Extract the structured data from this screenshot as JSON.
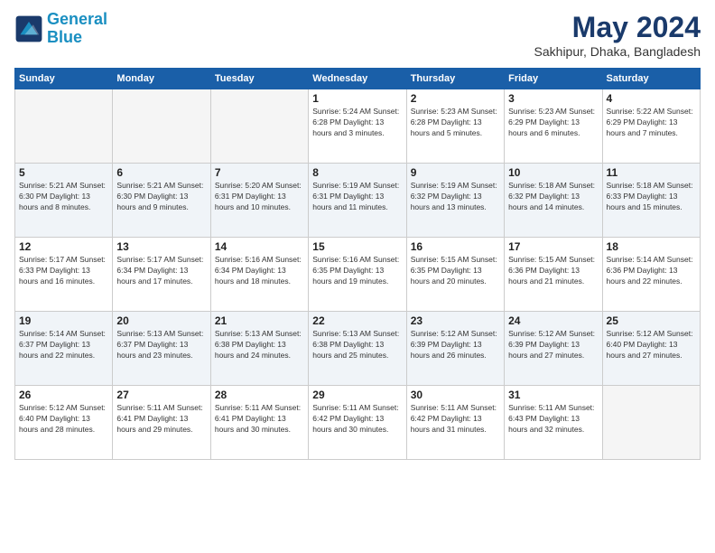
{
  "header": {
    "logo_line1": "General",
    "logo_line2": "Blue",
    "month": "May 2024",
    "location": "Sakhipur, Dhaka, Bangladesh"
  },
  "weekdays": [
    "Sunday",
    "Monday",
    "Tuesday",
    "Wednesday",
    "Thursday",
    "Friday",
    "Saturday"
  ],
  "weeks": [
    [
      {
        "day": "",
        "info": ""
      },
      {
        "day": "",
        "info": ""
      },
      {
        "day": "",
        "info": ""
      },
      {
        "day": "1",
        "info": "Sunrise: 5:24 AM\nSunset: 6:28 PM\nDaylight: 13 hours and 3 minutes."
      },
      {
        "day": "2",
        "info": "Sunrise: 5:23 AM\nSunset: 6:28 PM\nDaylight: 13 hours and 5 minutes."
      },
      {
        "day": "3",
        "info": "Sunrise: 5:23 AM\nSunset: 6:29 PM\nDaylight: 13 hours and 6 minutes."
      },
      {
        "day": "4",
        "info": "Sunrise: 5:22 AM\nSunset: 6:29 PM\nDaylight: 13 hours and 7 minutes."
      }
    ],
    [
      {
        "day": "5",
        "info": "Sunrise: 5:21 AM\nSunset: 6:30 PM\nDaylight: 13 hours and 8 minutes."
      },
      {
        "day": "6",
        "info": "Sunrise: 5:21 AM\nSunset: 6:30 PM\nDaylight: 13 hours and 9 minutes."
      },
      {
        "day": "7",
        "info": "Sunrise: 5:20 AM\nSunset: 6:31 PM\nDaylight: 13 hours and 10 minutes."
      },
      {
        "day": "8",
        "info": "Sunrise: 5:19 AM\nSunset: 6:31 PM\nDaylight: 13 hours and 11 minutes."
      },
      {
        "day": "9",
        "info": "Sunrise: 5:19 AM\nSunset: 6:32 PM\nDaylight: 13 hours and 13 minutes."
      },
      {
        "day": "10",
        "info": "Sunrise: 5:18 AM\nSunset: 6:32 PM\nDaylight: 13 hours and 14 minutes."
      },
      {
        "day": "11",
        "info": "Sunrise: 5:18 AM\nSunset: 6:33 PM\nDaylight: 13 hours and 15 minutes."
      }
    ],
    [
      {
        "day": "12",
        "info": "Sunrise: 5:17 AM\nSunset: 6:33 PM\nDaylight: 13 hours and 16 minutes."
      },
      {
        "day": "13",
        "info": "Sunrise: 5:17 AM\nSunset: 6:34 PM\nDaylight: 13 hours and 17 minutes."
      },
      {
        "day": "14",
        "info": "Sunrise: 5:16 AM\nSunset: 6:34 PM\nDaylight: 13 hours and 18 minutes."
      },
      {
        "day": "15",
        "info": "Sunrise: 5:16 AM\nSunset: 6:35 PM\nDaylight: 13 hours and 19 minutes."
      },
      {
        "day": "16",
        "info": "Sunrise: 5:15 AM\nSunset: 6:35 PM\nDaylight: 13 hours and 20 minutes."
      },
      {
        "day": "17",
        "info": "Sunrise: 5:15 AM\nSunset: 6:36 PM\nDaylight: 13 hours and 21 minutes."
      },
      {
        "day": "18",
        "info": "Sunrise: 5:14 AM\nSunset: 6:36 PM\nDaylight: 13 hours and 22 minutes."
      }
    ],
    [
      {
        "day": "19",
        "info": "Sunrise: 5:14 AM\nSunset: 6:37 PM\nDaylight: 13 hours and 22 minutes."
      },
      {
        "day": "20",
        "info": "Sunrise: 5:13 AM\nSunset: 6:37 PM\nDaylight: 13 hours and 23 minutes."
      },
      {
        "day": "21",
        "info": "Sunrise: 5:13 AM\nSunset: 6:38 PM\nDaylight: 13 hours and 24 minutes."
      },
      {
        "day": "22",
        "info": "Sunrise: 5:13 AM\nSunset: 6:38 PM\nDaylight: 13 hours and 25 minutes."
      },
      {
        "day": "23",
        "info": "Sunrise: 5:12 AM\nSunset: 6:39 PM\nDaylight: 13 hours and 26 minutes."
      },
      {
        "day": "24",
        "info": "Sunrise: 5:12 AM\nSunset: 6:39 PM\nDaylight: 13 hours and 27 minutes."
      },
      {
        "day": "25",
        "info": "Sunrise: 5:12 AM\nSunset: 6:40 PM\nDaylight: 13 hours and 27 minutes."
      }
    ],
    [
      {
        "day": "26",
        "info": "Sunrise: 5:12 AM\nSunset: 6:40 PM\nDaylight: 13 hours and 28 minutes."
      },
      {
        "day": "27",
        "info": "Sunrise: 5:11 AM\nSunset: 6:41 PM\nDaylight: 13 hours and 29 minutes."
      },
      {
        "day": "28",
        "info": "Sunrise: 5:11 AM\nSunset: 6:41 PM\nDaylight: 13 hours and 30 minutes."
      },
      {
        "day": "29",
        "info": "Sunrise: 5:11 AM\nSunset: 6:42 PM\nDaylight: 13 hours and 30 minutes."
      },
      {
        "day": "30",
        "info": "Sunrise: 5:11 AM\nSunset: 6:42 PM\nDaylight: 13 hours and 31 minutes."
      },
      {
        "day": "31",
        "info": "Sunrise: 5:11 AM\nSunset: 6:43 PM\nDaylight: 13 hours and 32 minutes."
      },
      {
        "day": "",
        "info": ""
      }
    ]
  ]
}
